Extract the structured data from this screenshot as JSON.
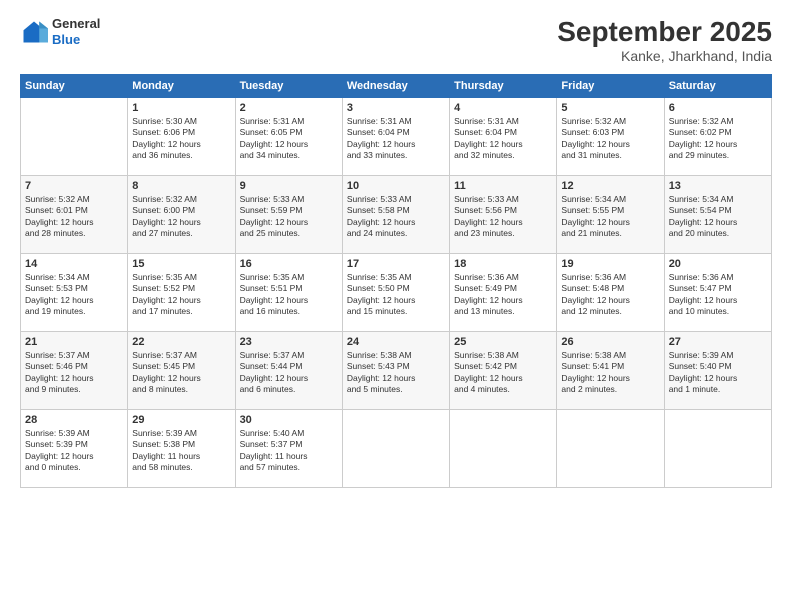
{
  "header": {
    "logo_line1": "General",
    "logo_line2": "Blue",
    "month": "September 2025",
    "location": "Kanke, Jharkhand, India"
  },
  "days_of_week": [
    "Sunday",
    "Monday",
    "Tuesday",
    "Wednesday",
    "Thursday",
    "Friday",
    "Saturday"
  ],
  "weeks": [
    [
      {
        "day": "",
        "content": ""
      },
      {
        "day": "1",
        "content": "Sunrise: 5:30 AM\nSunset: 6:06 PM\nDaylight: 12 hours\nand 36 minutes."
      },
      {
        "day": "2",
        "content": "Sunrise: 5:31 AM\nSunset: 6:05 PM\nDaylight: 12 hours\nand 34 minutes."
      },
      {
        "day": "3",
        "content": "Sunrise: 5:31 AM\nSunset: 6:04 PM\nDaylight: 12 hours\nand 33 minutes."
      },
      {
        "day": "4",
        "content": "Sunrise: 5:31 AM\nSunset: 6:04 PM\nDaylight: 12 hours\nand 32 minutes."
      },
      {
        "day": "5",
        "content": "Sunrise: 5:32 AM\nSunset: 6:03 PM\nDaylight: 12 hours\nand 31 minutes."
      },
      {
        "day": "6",
        "content": "Sunrise: 5:32 AM\nSunset: 6:02 PM\nDaylight: 12 hours\nand 29 minutes."
      }
    ],
    [
      {
        "day": "7",
        "content": "Sunrise: 5:32 AM\nSunset: 6:01 PM\nDaylight: 12 hours\nand 28 minutes."
      },
      {
        "day": "8",
        "content": "Sunrise: 5:32 AM\nSunset: 6:00 PM\nDaylight: 12 hours\nand 27 minutes."
      },
      {
        "day": "9",
        "content": "Sunrise: 5:33 AM\nSunset: 5:59 PM\nDaylight: 12 hours\nand 25 minutes."
      },
      {
        "day": "10",
        "content": "Sunrise: 5:33 AM\nSunset: 5:58 PM\nDaylight: 12 hours\nand 24 minutes."
      },
      {
        "day": "11",
        "content": "Sunrise: 5:33 AM\nSunset: 5:56 PM\nDaylight: 12 hours\nand 23 minutes."
      },
      {
        "day": "12",
        "content": "Sunrise: 5:34 AM\nSunset: 5:55 PM\nDaylight: 12 hours\nand 21 minutes."
      },
      {
        "day": "13",
        "content": "Sunrise: 5:34 AM\nSunset: 5:54 PM\nDaylight: 12 hours\nand 20 minutes."
      }
    ],
    [
      {
        "day": "14",
        "content": "Sunrise: 5:34 AM\nSunset: 5:53 PM\nDaylight: 12 hours\nand 19 minutes."
      },
      {
        "day": "15",
        "content": "Sunrise: 5:35 AM\nSunset: 5:52 PM\nDaylight: 12 hours\nand 17 minutes."
      },
      {
        "day": "16",
        "content": "Sunrise: 5:35 AM\nSunset: 5:51 PM\nDaylight: 12 hours\nand 16 minutes."
      },
      {
        "day": "17",
        "content": "Sunrise: 5:35 AM\nSunset: 5:50 PM\nDaylight: 12 hours\nand 15 minutes."
      },
      {
        "day": "18",
        "content": "Sunrise: 5:36 AM\nSunset: 5:49 PM\nDaylight: 12 hours\nand 13 minutes."
      },
      {
        "day": "19",
        "content": "Sunrise: 5:36 AM\nSunset: 5:48 PM\nDaylight: 12 hours\nand 12 minutes."
      },
      {
        "day": "20",
        "content": "Sunrise: 5:36 AM\nSunset: 5:47 PM\nDaylight: 12 hours\nand 10 minutes."
      }
    ],
    [
      {
        "day": "21",
        "content": "Sunrise: 5:37 AM\nSunset: 5:46 PM\nDaylight: 12 hours\nand 9 minutes."
      },
      {
        "day": "22",
        "content": "Sunrise: 5:37 AM\nSunset: 5:45 PM\nDaylight: 12 hours\nand 8 minutes."
      },
      {
        "day": "23",
        "content": "Sunrise: 5:37 AM\nSunset: 5:44 PM\nDaylight: 12 hours\nand 6 minutes."
      },
      {
        "day": "24",
        "content": "Sunrise: 5:38 AM\nSunset: 5:43 PM\nDaylight: 12 hours\nand 5 minutes."
      },
      {
        "day": "25",
        "content": "Sunrise: 5:38 AM\nSunset: 5:42 PM\nDaylight: 12 hours\nand 4 minutes."
      },
      {
        "day": "26",
        "content": "Sunrise: 5:38 AM\nSunset: 5:41 PM\nDaylight: 12 hours\nand 2 minutes."
      },
      {
        "day": "27",
        "content": "Sunrise: 5:39 AM\nSunset: 5:40 PM\nDaylight: 12 hours\nand 1 minute."
      }
    ],
    [
      {
        "day": "28",
        "content": "Sunrise: 5:39 AM\nSunset: 5:39 PM\nDaylight: 12 hours\nand 0 minutes."
      },
      {
        "day": "29",
        "content": "Sunrise: 5:39 AM\nSunset: 5:38 PM\nDaylight: 11 hours\nand 58 minutes."
      },
      {
        "day": "30",
        "content": "Sunrise: 5:40 AM\nSunset: 5:37 PM\nDaylight: 11 hours\nand 57 minutes."
      },
      {
        "day": "",
        "content": ""
      },
      {
        "day": "",
        "content": ""
      },
      {
        "day": "",
        "content": ""
      },
      {
        "day": "",
        "content": ""
      }
    ]
  ]
}
